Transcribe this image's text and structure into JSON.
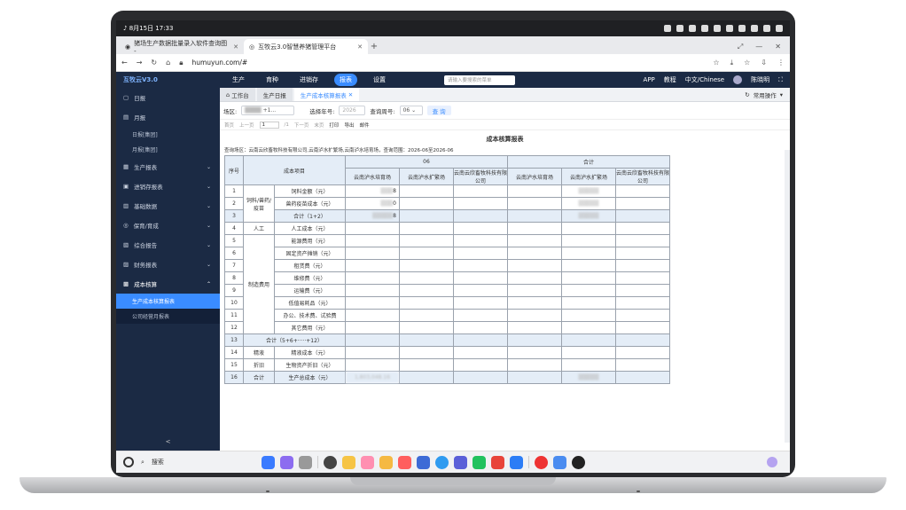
{
  "status_bar": {
    "datetime": "8月15日 17:33"
  },
  "browser": {
    "tabs": [
      {
        "label": "猪场生产数据批量录入软件查询图 -"
      },
      {
        "label": "互牧云3.0智慧养猪管理平台"
      }
    ],
    "url": "humuyun.com/#"
  },
  "app": {
    "logo": "互牧云V3.0",
    "nav": [
      {
        "label": "生产"
      },
      {
        "label": "育种"
      },
      {
        "label": "进销存"
      },
      {
        "label": "报表"
      },
      {
        "label": "设置"
      }
    ],
    "search_placeholder": "请输入要搜索的菜单",
    "header_right": {
      "app": "APP",
      "help": "教程",
      "language": "中文/Chinese",
      "user": "陈晓明"
    }
  },
  "sidebar": {
    "items": [
      {
        "label": "日报",
        "icon": "calendar-icon"
      },
      {
        "label": "月报",
        "icon": "month-icon"
      }
    ],
    "sub_month": [
      {
        "label": "日报[集团]"
      },
      {
        "label": "月报[集团]"
      }
    ],
    "groups": [
      {
        "label": "生产报表"
      },
      {
        "label": "进销存报表"
      },
      {
        "label": "基础数据"
      },
      {
        "label": "保育/育成"
      },
      {
        "label": "综合报告"
      },
      {
        "label": "财务报表"
      },
      {
        "label": "成本核算"
      }
    ],
    "sub_cost": [
      {
        "label": "生产成本核算报表"
      },
      {
        "label": "公司经营月报表"
      }
    ],
    "collapse": "<"
  },
  "page_tabs": [
    {
      "label": "工作台"
    },
    {
      "label": "生产日报"
    },
    {
      "label": "生产成本核算报表"
    }
  ],
  "common_ops": "常用操作",
  "filter": {
    "farm_label": "场区:",
    "farm_value": "+1...",
    "year_label": "选择年号:",
    "year_value": "2026",
    "period_label": "查询周号:",
    "period_value": "06",
    "query_button": "查 询"
  },
  "pager": {
    "first": "首页",
    "prev": "上一页",
    "page": "1",
    "total": "/1",
    "next": "下一页",
    "last": "末页",
    "print": "打印",
    "export": "导出",
    "email": "邮件"
  },
  "report": {
    "title": "成本核算报表",
    "info": "查询场区：云南云欣畜牧科技有限公司,云南泸水扩繁场,云南泸水培育场，查询范围：2026-06至2026-06",
    "headers": {
      "no": "序号",
      "item": "成本项目",
      "period": "06",
      "total": "合计"
    },
    "farms": [
      "云南泸水培育场",
      "云南泸水扩繁场",
      "云南云欣畜牧科技有限公司"
    ],
    "rows": [
      {
        "no": "1",
        "cat": "饲料/兽药/疫苗",
        "item": "饲料金额（元）",
        "v1": "8"
      },
      {
        "no": "2",
        "cat": "",
        "item": "兽药疫苗成本（元）",
        "v1": "0"
      },
      {
        "no": "3",
        "cat": "",
        "item": "合计（1+2）",
        "v1": "8"
      },
      {
        "no": "4",
        "cat": "人工",
        "item": "人工成本（元）",
        "v1": ""
      },
      {
        "no": "5",
        "cat": "制造费用",
        "item": "能源费用（元）",
        "v1": ""
      },
      {
        "no": "6",
        "cat": "",
        "item": "固定资产摊销（元）",
        "v1": ""
      },
      {
        "no": "7",
        "cat": "",
        "item": "租赁费（元）",
        "v1": ""
      },
      {
        "no": "8",
        "cat": "",
        "item": "维修费（元）",
        "v1": ""
      },
      {
        "no": "9",
        "cat": "",
        "item": "运输费（元）",
        "v1": ""
      },
      {
        "no": "10",
        "cat": "",
        "item": "低值易耗品（元）",
        "v1": ""
      },
      {
        "no": "11",
        "cat": "",
        "item": "办公、技术费、试验费",
        "v1": ""
      },
      {
        "no": "12",
        "cat": "",
        "item": "其它费用（元）",
        "v1": ""
      },
      {
        "no": "13",
        "cat": "",
        "item": "合计（5+6+·····+12）",
        "v1": ""
      },
      {
        "no": "14",
        "cat": "精液",
        "item": "精液成本（元）",
        "v1": ""
      },
      {
        "no": "15",
        "cat": "折旧",
        "item": "生物资产折旧（元）",
        "v1": ""
      },
      {
        "no": "16",
        "cat": "合计",
        "item": "生产总成本（元）",
        "v1": "1,803,048.16"
      }
    ]
  },
  "dock": {
    "search": "搜索"
  }
}
